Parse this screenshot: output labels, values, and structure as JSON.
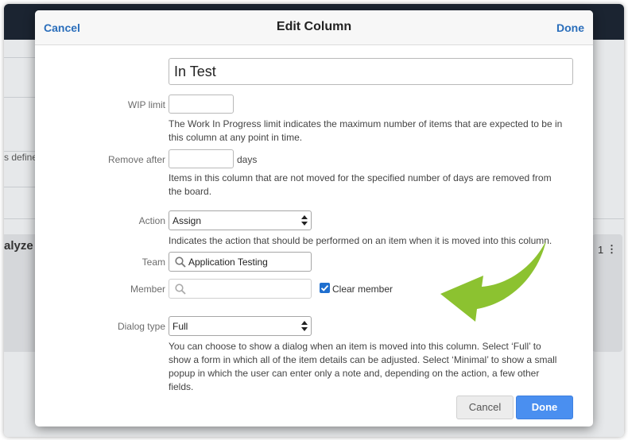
{
  "background": {
    "snippet_defined": "s defined",
    "snippet_analyze": "alyze",
    "card_count": "1"
  },
  "dialog": {
    "cancel_label": "Cancel",
    "title": "Edit Column",
    "done_label": "Done"
  },
  "form": {
    "column_name_value": "In Test",
    "wip_label": "WIP limit",
    "wip_value": "",
    "wip_help": "The Work In Progress limit indicates the maximum number of items that are expected to be in this column at any point in time.",
    "remove_after_label": "Remove after",
    "remove_after_value": "",
    "remove_after_unit": "days",
    "remove_after_help": "Items in this column that are not moved for the specified number of days are removed from the board.",
    "action_label": "Action",
    "action_value": "Assign",
    "action_help": "Indicates the action that should be performed on an item when it is moved into this column.",
    "team_label": "Team",
    "team_value": "Application Testing",
    "member_label": "Member",
    "member_value": "",
    "clear_member_label": "Clear member",
    "clear_member_checked": true,
    "dialog_type_label": "Dialog type",
    "dialog_type_value": "Full",
    "dialog_type_help": "You can choose to show a dialog when an item is moved into this column. Select ‘Full’ to show a form in which all of the item details can be adjusted. Select ‘Minimal’ to show a small popup in which the user can enter only a note and, depending on the action, a few other fields."
  },
  "footer": {
    "cancel_label": "Cancel",
    "done_label": "Done"
  },
  "colors": {
    "link": "#2a6ebb",
    "primary_button": "#4a8ff0",
    "annotation_arrow": "#8cc230",
    "app_header": "#1b2431"
  },
  "icons": {
    "select_arrow": "updown-arrow-icon",
    "search": "magnifier-icon",
    "checkbox": "checkmark-icon",
    "annotation": "curved-arrow-icon"
  }
}
